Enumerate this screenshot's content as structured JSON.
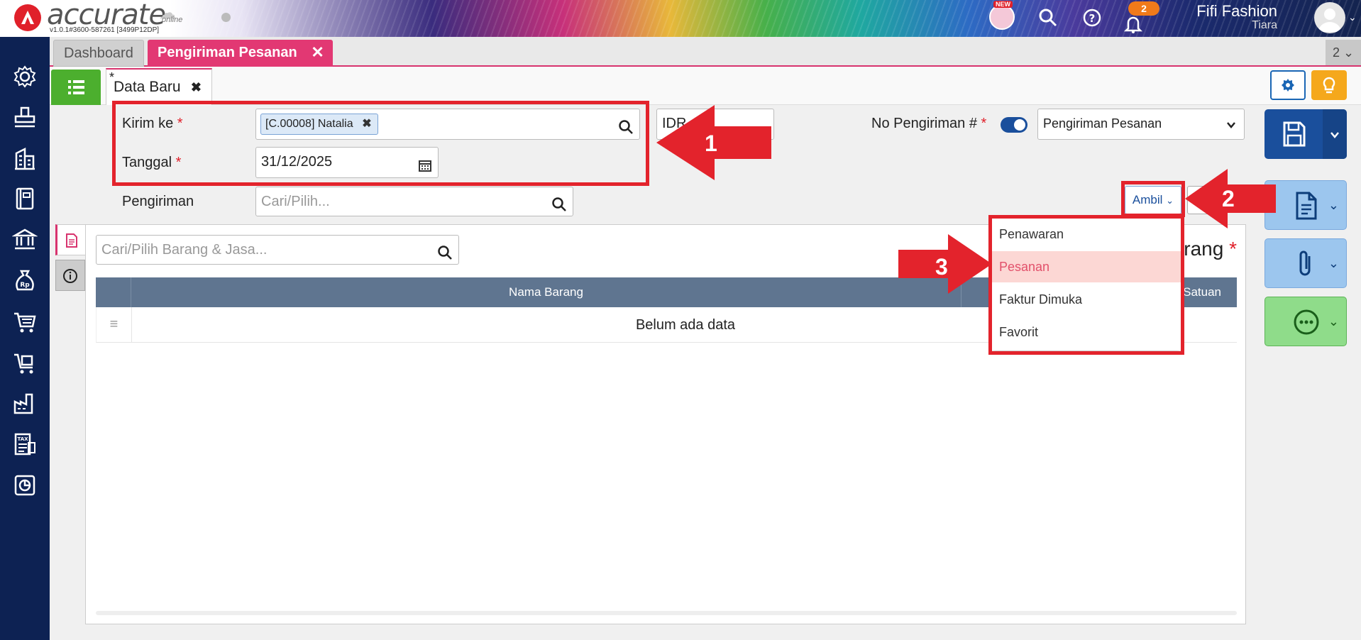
{
  "app": {
    "logo_text": "accurate",
    "logo_sub": "online",
    "version": "v1.0.1#3600-587261 [3499P12DP]",
    "new_badge": "NEW",
    "notification_count": "2",
    "user_company": "Fifi Fashion",
    "user_name": "Tiara"
  },
  "sidebar": {
    "icons": [
      "gear-icon",
      "stamp-icon",
      "building-icon",
      "book-icon",
      "bank-icon",
      "money-bag-icon",
      "cart-icon",
      "cart-box-icon",
      "factory-icon",
      "tax-icon",
      "report-icon"
    ]
  },
  "tabs": {
    "items": [
      {
        "label": "Dashboard"
      },
      {
        "label": "Pengiriman Pesanan"
      }
    ],
    "count": "2"
  },
  "subtab": {
    "modified_marker": "*",
    "label": "Data Baru"
  },
  "form": {
    "kirim_ke_label": "Kirim ke",
    "required_mark": "*",
    "customer_chip": "[C.00008] Natalia",
    "tanggal_label": "Tanggal",
    "tanggal_value": "31/12/2025",
    "currency_value": "IDR",
    "no_pengiriman_label": "No Pengiriman #",
    "no_pengiriman_toggle_on": true,
    "no_pengiriman_type": "Pengiriman Pesanan",
    "pengiriman_label": "Pengiriman",
    "pengiriman_placeholder": "Cari/Pilih..."
  },
  "ambil": {
    "label": "Ambil",
    "options": [
      "Penawaran",
      "Pesanan",
      "Faktur Dimuka",
      "Favorit"
    ],
    "highlighted": "Pesanan"
  },
  "items_panel": {
    "search_placeholder": "Cari/Pilih Barang & Jasa...",
    "title_fragment": "rang",
    "columns": [
      "Nama Barang",
      "Satuan"
    ],
    "empty_text": "Belum ada data"
  },
  "annotations": {
    "step1": "1",
    "step2": "2",
    "step3": "3",
    "color": "#e3232c"
  },
  "colors": {
    "sidebar": "#0d2253",
    "tab_active": "#e23873",
    "primary": "#1a4f9c",
    "list_button": "#4caf2e",
    "table_header": "#5f7590"
  }
}
